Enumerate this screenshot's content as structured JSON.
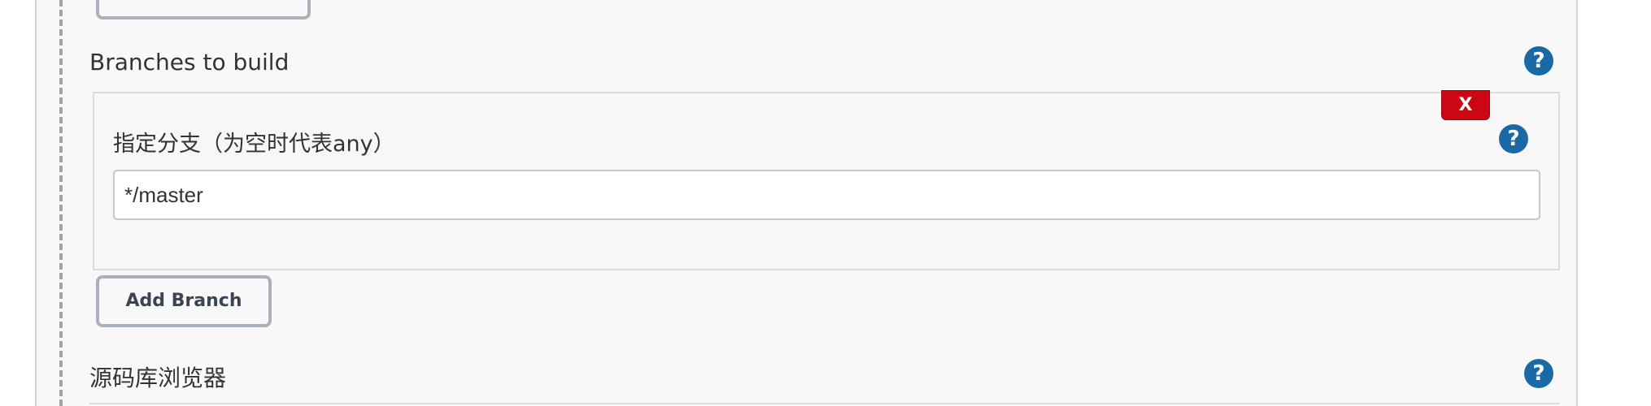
{
  "branches_section": {
    "label": "Branches to build",
    "help_icon": "?"
  },
  "branch_spec": {
    "label": "指定分支（为空时代表any）",
    "value": "*/master",
    "delete_label": "X",
    "help_icon": "?"
  },
  "add_branch": {
    "label": "Add Branch"
  },
  "repo_browser_section": {
    "label": "源码库浏览器",
    "help_icon": "?"
  },
  "colors": {
    "help_icon": "#1a69a7",
    "delete_button": "#cc0714",
    "panel_background": "#f8f8f8"
  }
}
